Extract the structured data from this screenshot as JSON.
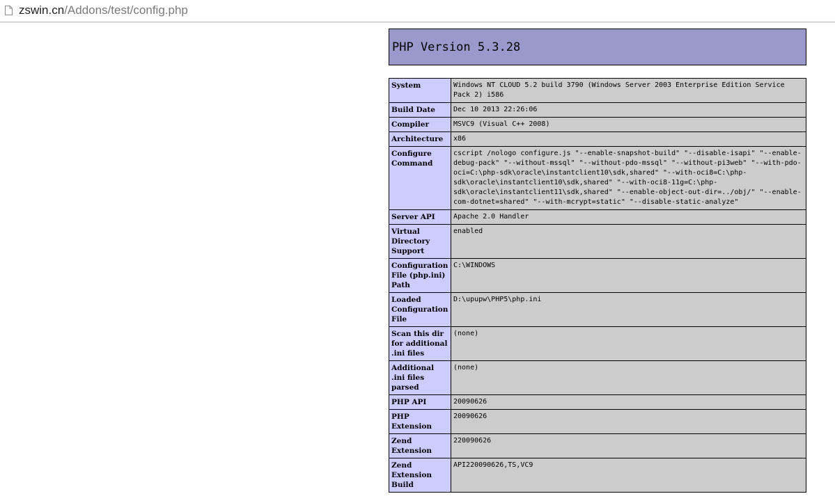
{
  "browser": {
    "url_host": "zswin.cn",
    "url_path": "/Addons/test/config.php",
    "page_icon": "page-icon"
  },
  "phpinfo": {
    "title": "PHP Version 5.3.28",
    "rows": [
      {
        "label": "System",
        "value": "Windows NT CLOUD 5.2 build 3790 (Windows Server 2003 Enterprise Edition Service Pack 2) i586"
      },
      {
        "label": "Build Date",
        "value": "Dec 10 2013 22:26:06"
      },
      {
        "label": "Compiler",
        "value": "MSVC9 (Visual C++ 2008)"
      },
      {
        "label": "Architecture",
        "value": "x86"
      },
      {
        "label": "Configure Command",
        "value": "cscript /nologo configure.js \"--enable-snapshot-build\" \"--disable-isapi\" \"--enable-debug-pack\" \"--without-mssql\" \"--without-pdo-mssql\" \"--without-pi3web\" \"--with-pdo-oci=C:\\php-sdk\\oracle\\instantclient10\\sdk,shared\" \"--with-oci8=C:\\php-sdk\\oracle\\instantclient10\\sdk,shared\" \"--with-oci8-11g=C:\\php-sdk\\oracle\\instantclient11\\sdk,shared\" \"--enable-object-out-dir=../obj/\" \"--enable-com-dotnet=shared\" \"--with-mcrypt=static\" \"--disable-static-analyze\""
      },
      {
        "label": "Server API",
        "value": "Apache 2.0 Handler"
      },
      {
        "label": "Virtual Directory Support",
        "value": "enabled"
      },
      {
        "label": "Configuration File (php.ini) Path",
        "value": "C:\\WINDOWS"
      },
      {
        "label": "Loaded Configuration File",
        "value": "D:\\upupw\\PHP5\\php.ini"
      },
      {
        "label": "Scan this dir for additional .ini files",
        "value": "(none)"
      },
      {
        "label": "Additional .ini files parsed",
        "value": "(none)"
      },
      {
        "label": "PHP API",
        "value": "20090626"
      },
      {
        "label": "PHP Extension",
        "value": "20090626"
      },
      {
        "label": "Zend Extension",
        "value": "220090626"
      },
      {
        "label": "Zend Extension Build",
        "value": "API220090626,TS,VC9"
      }
    ]
  },
  "colors": {
    "header_bg": "#9999cc",
    "label_bg": "#ccccff",
    "value_bg": "#cccccc"
  }
}
